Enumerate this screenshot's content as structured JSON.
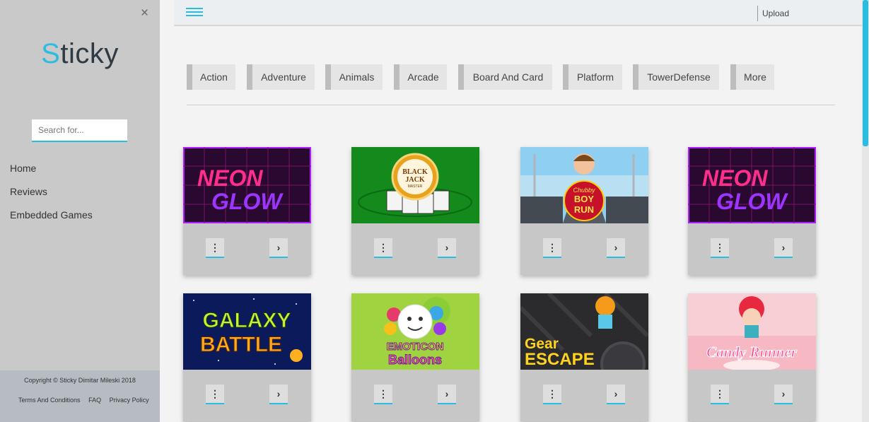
{
  "sidebar": {
    "logo_first": "S",
    "logo_rest": "ticky",
    "search_placeholder": "Search for...",
    "nav": [
      "Home",
      "Reviews",
      "Embedded Games"
    ],
    "close_glyph": "×",
    "footer": {
      "copyright": "Copyright © Sticky Dimitar Mileski 2018",
      "links": [
        "Terms And Conditions",
        "FAQ",
        "Privacy Policy"
      ]
    }
  },
  "topbar": {
    "upload_label": "Upload"
  },
  "categories": [
    "Action",
    "Adventure",
    "Animals",
    "Arcade",
    "Board And Card",
    "Platform",
    "TowerDefense",
    "More"
  ],
  "games": [
    {
      "title_lines": [
        "NEON",
        "GLOW"
      ],
      "art": "neon"
    },
    {
      "title_lines": [
        "BLACK",
        "JACK",
        "MASTER"
      ],
      "art": "blackjack"
    },
    {
      "title_lines": [
        "Chubby",
        "BOY",
        "RUN"
      ],
      "art": "chubby"
    },
    {
      "title_lines": [
        "NEON",
        "GLOW"
      ],
      "art": "neon"
    },
    {
      "title_lines": [
        "GALAXY",
        "BATTLE"
      ],
      "art": "galaxy"
    },
    {
      "title_lines": [
        "EMOTICON",
        "Balloons"
      ],
      "art": "emoticon"
    },
    {
      "title_lines": [
        "Gear",
        "ESCAPE"
      ],
      "art": "gear"
    },
    {
      "title_lines": [
        "Candy Runner"
      ],
      "art": "candy"
    }
  ],
  "card_buttons": {
    "more_glyph": "⋮",
    "play_glyph": "›"
  },
  "colors": {
    "accent": "#2bbde0",
    "sidebar": "#c9c9c9",
    "footer": "#b7bcc2"
  }
}
